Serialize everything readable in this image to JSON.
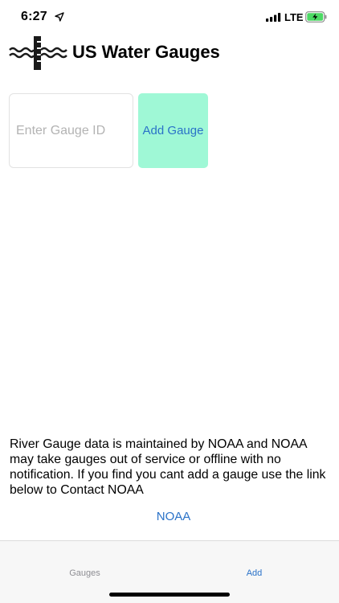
{
  "status_bar": {
    "time": "6:27",
    "network": "LTE",
    "icons": [
      "location-arrow-icon",
      "signal-bars-icon",
      "battery-charging-icon"
    ],
    "battery_color": "#4cd964"
  },
  "header": {
    "title": "US Water Gauges",
    "logo_icon": "water-gauge-logo-icon"
  },
  "form": {
    "gauge_id_placeholder": "Enter Gauge ID",
    "gauge_id_value": "",
    "add_button_label": "Add Gauge",
    "add_button_color": "#9ff8d6"
  },
  "info": {
    "disclaimer": "River Gauge data is maintained by NOAA and NOAA may take gauges out of service or offline with no notification.  If you find you cant add a gauge use the link below to Contact NOAA",
    "link_label": "NOAA",
    "link_color": "#2a72c8"
  },
  "tab_bar": {
    "tabs": [
      {
        "label": "Gauges",
        "active": false
      },
      {
        "label": "Add",
        "active": true
      }
    ]
  }
}
